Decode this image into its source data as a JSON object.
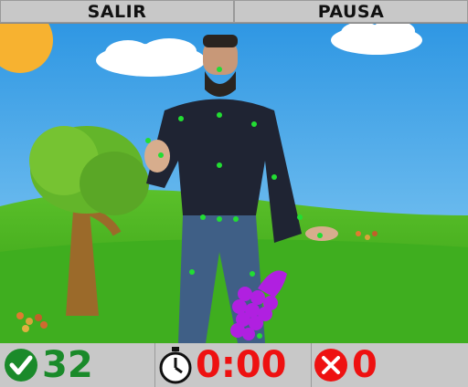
{
  "menu": {
    "exit_label": "SALIR",
    "pause_label": "PAUSA"
  },
  "hud": {
    "hits": "32",
    "timer": "0:00",
    "misses": "0",
    "hit_icon": "check-circle-icon",
    "timer_icon": "stopwatch-icon",
    "miss_icon": "x-circle-icon"
  },
  "colors": {
    "sky": "#3aa2e8",
    "grass": "#3fae1f",
    "sun": "#f7b230",
    "fruit": "#b020e0",
    "keypoint": "#22dd33",
    "hit": "#1a8a2a",
    "miss": "#ee1111",
    "bar": "#c8c8c8"
  },
  "scene": {
    "objects": [
      "sun",
      "cloud",
      "cloud",
      "tree",
      "grapes",
      "player-with-pose-keypoints"
    ]
  }
}
